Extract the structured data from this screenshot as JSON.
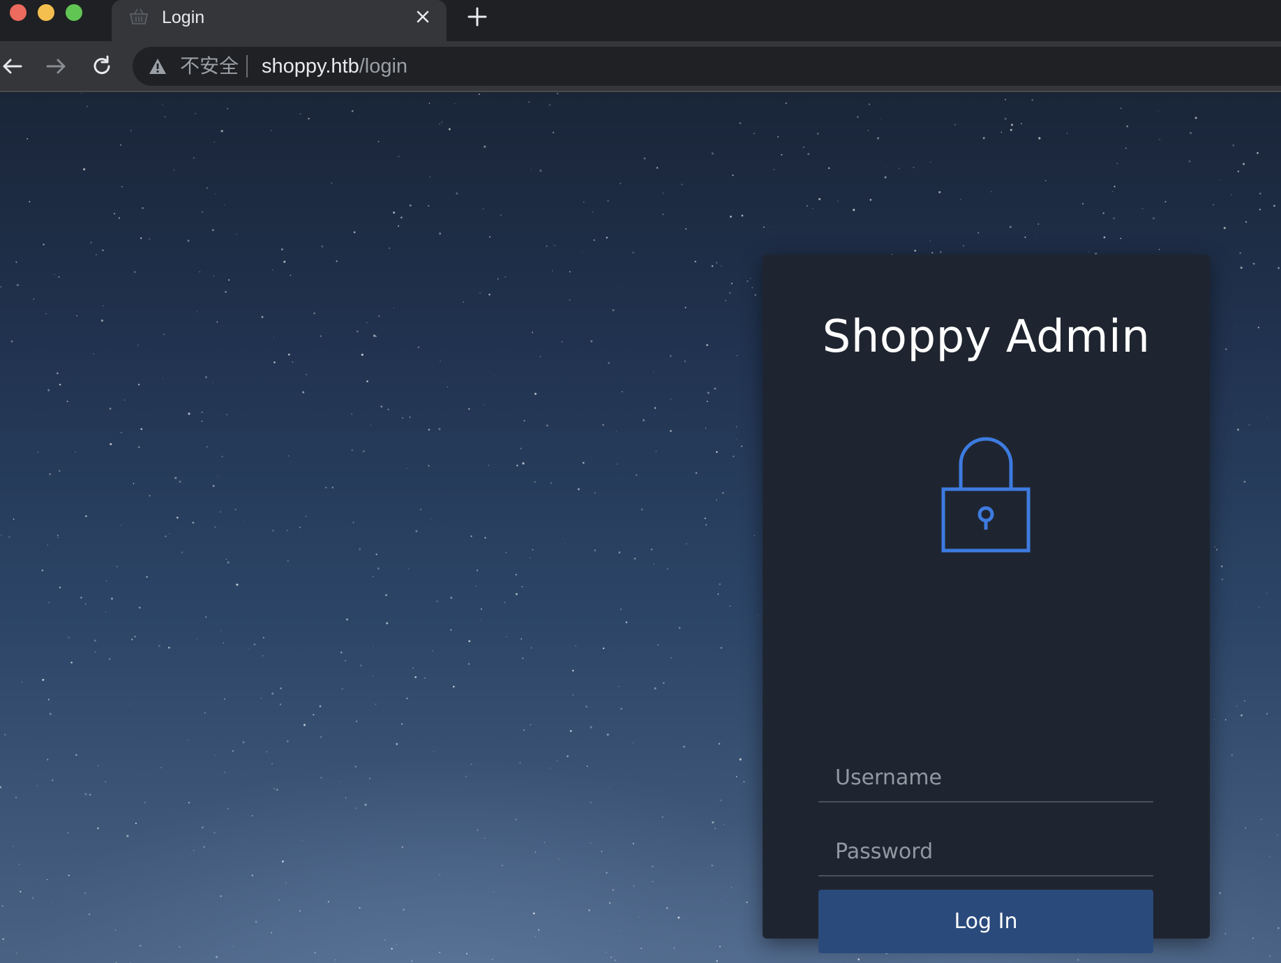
{
  "browser": {
    "tab_title": "Login",
    "security_label": "不安全",
    "url_host": "shoppy.htb",
    "url_path": "/login"
  },
  "login": {
    "title": "Shoppy Admin",
    "username_placeholder": "Username",
    "password_placeholder": "Password",
    "submit_label": "Log In"
  },
  "icons": {
    "favicon": "basket-icon",
    "lock": "padlock-icon",
    "warning": "warning-triangle-icon"
  },
  "colors": {
    "accent_blue": "#3d7be0",
    "button_bg": "#2a4a7c",
    "card_bg": "#1f2530"
  }
}
